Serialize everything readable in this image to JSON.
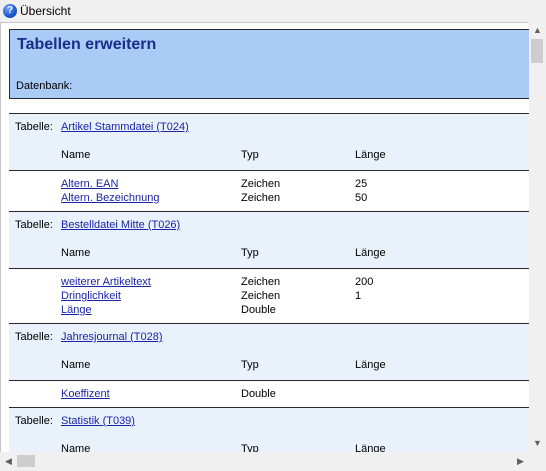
{
  "window": {
    "title": "Übersicht",
    "help_icon": "help-icon"
  },
  "header": {
    "title": "Tabellen erweitern",
    "db_label": "Datenbank:"
  },
  "columns": {
    "name": "Name",
    "typ": "Typ",
    "laenge": "Länge"
  },
  "table_label": "Tabelle:",
  "sections": [
    {
      "title": "Artikel Stammdatei (T024)",
      "rows": [
        {
          "name": "Altern. EAN",
          "typ": "Zeichen",
          "laenge": "25"
        },
        {
          "name": "Altern. Bezeichnung",
          "typ": "Zeichen",
          "laenge": "50"
        }
      ]
    },
    {
      "title": "Bestelldatei Mitte (T026)",
      "rows": [
        {
          "name": "weiterer Artikeltext",
          "typ": "Zeichen",
          "laenge": "200"
        },
        {
          "name": "Dringlichkeit",
          "typ": "Zeichen",
          "laenge": "1"
        },
        {
          "name": "Länge",
          "typ": "Double",
          "laenge": ""
        }
      ]
    },
    {
      "title": "Jahresjournal (T028)",
      "rows": [
        {
          "name": "Koeffizent",
          "typ": "Double",
          "laenge": ""
        }
      ]
    },
    {
      "title": "Statistik (T039)",
      "rows": []
    }
  ],
  "scrollbar": {
    "up": "▲",
    "down": "▼",
    "left": "◀",
    "right": "▶"
  }
}
